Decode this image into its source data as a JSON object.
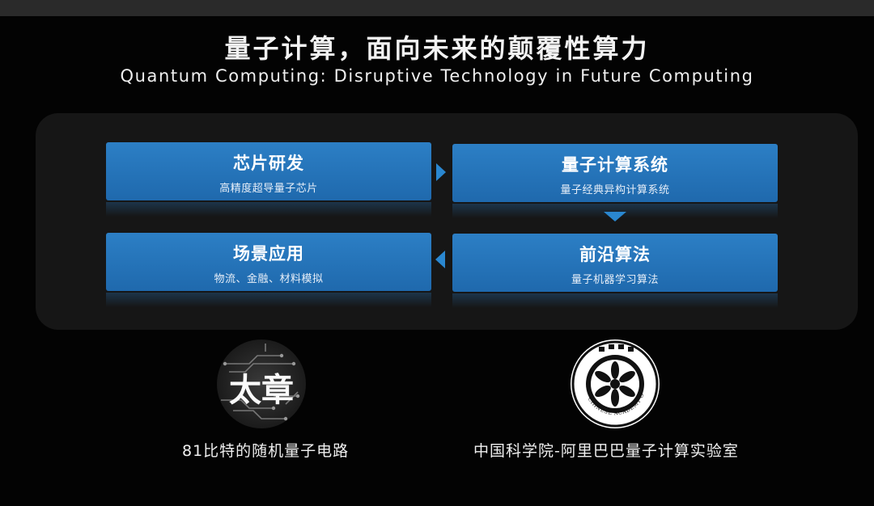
{
  "title_cn": "量子计算，面向未来的颠覆性算力",
  "title_en": "Quantum Computing: Disruptive Technology in Future Computing",
  "flow": {
    "chip": {
      "title": "芯片研发",
      "subtitle": "高精度超导量子芯片"
    },
    "system": {
      "title": "量子计算系统",
      "subtitle": "量子经典异构计算系统"
    },
    "algorithm": {
      "title": "前沿算法",
      "subtitle": "量子机器学习算法"
    },
    "application": {
      "title": "场景应用",
      "subtitle": "物流、金融、材料模拟"
    }
  },
  "logos": {
    "left_mark": "太章",
    "left_caption": "81比特的随机量子电路",
    "right_mark_text": "中國科學院 CHINESE ACADEMY OF SCIENCES",
    "right_caption": "中国科学院-阿里巴巴量子计算实验室"
  },
  "colors": {
    "box": "#2474ba",
    "arrow": "#2a87d0",
    "panel": "#161616"
  },
  "icons": [
    "arrow-right-icon",
    "arrow-down-icon",
    "arrow-left-icon",
    "taizhang-logo",
    "cas-logo"
  ]
}
